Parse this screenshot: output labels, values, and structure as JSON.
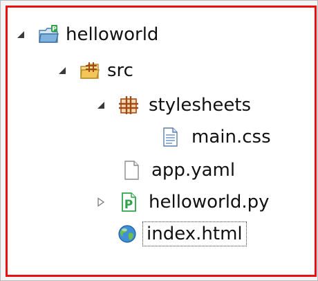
{
  "tree": {
    "items": [
      {
        "label": "helloworld",
        "icon": "python-project-folder-icon",
        "expanded": true
      },
      {
        "label": "src",
        "icon": "source-folder-icon",
        "expanded": true
      },
      {
        "label": "stylesheets",
        "icon": "package-folder-icon",
        "expanded": true
      },
      {
        "label": "main.css",
        "icon": "text-file-icon"
      },
      {
        "label": "app.yaml",
        "icon": "blank-file-icon"
      },
      {
        "label": "helloworld.py",
        "icon": "python-file-icon",
        "expanded": false
      },
      {
        "label": "index.html",
        "icon": "web-file-icon",
        "selected": true
      }
    ]
  },
  "colors": {
    "highlight_border": "#e81010",
    "python_green": "#2fa34a",
    "folder_yellow": "#f2c65a",
    "package_brown": "#a04a16"
  }
}
